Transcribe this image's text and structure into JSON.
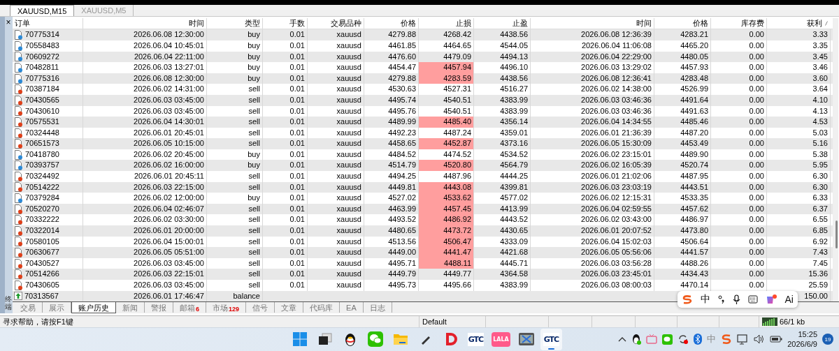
{
  "chart_tabs": [
    {
      "label": "XAUUSD,M15",
      "selected": true
    },
    {
      "label": "XAUUSD,M5",
      "selected": false
    }
  ],
  "terminal": {
    "close": "×",
    "title": "终端"
  },
  "table": {
    "columns": [
      "订单",
      "时间",
      "类型",
      "手数",
      "交易品种",
      "价格",
      "止损",
      "止盈",
      "时间",
      "价格",
      "库存费",
      "获利"
    ],
    "rows": [
      {
        "kind": "buy",
        "order": "70775314",
        "open_time": "2026.06.08 12:30:00",
        "type": "buy",
        "lots": "0.01",
        "symbol": "xauusd",
        "open_price": "4279.88",
        "sl": "4268.42",
        "sl_hit": false,
        "tp": "4438.56",
        "close_time": "2026.06.08 12:36:39",
        "close_price": "4283.21",
        "swap": "0.00",
        "profit": "3.33"
      },
      {
        "kind": "buy",
        "order": "70558483",
        "open_time": "2026.06.04 10:45:01",
        "type": "buy",
        "lots": "0.01",
        "symbol": "xauusd",
        "open_price": "4461.85",
        "sl": "4464.65",
        "sl_hit": false,
        "tp": "4544.05",
        "close_time": "2026.06.04 11:06:08",
        "close_price": "4465.20",
        "swap": "0.00",
        "profit": "3.35"
      },
      {
        "kind": "buy",
        "order": "70609272",
        "open_time": "2026.06.04 22:11:00",
        "type": "buy",
        "lots": "0.01",
        "symbol": "xauusd",
        "open_price": "4476.60",
        "sl": "4479.09",
        "sl_hit": false,
        "tp": "4494.13",
        "close_time": "2026.06.04 22:29:00",
        "close_price": "4480.05",
        "swap": "0.00",
        "profit": "3.45"
      },
      {
        "kind": "buy",
        "order": "70482811",
        "open_time": "2026.06.03 13:27:01",
        "type": "buy",
        "lots": "0.01",
        "symbol": "xauusd",
        "open_price": "4454.47",
        "sl": "4457.94",
        "sl_hit": true,
        "tp": "4496.10",
        "close_time": "2026.06.03 13:29:02",
        "close_price": "4457.93",
        "swap": "0.00",
        "profit": "3.46"
      },
      {
        "kind": "buy",
        "order": "70775316",
        "open_time": "2026.06.08 12:30:00",
        "type": "buy",
        "lots": "0.01",
        "symbol": "xauusd",
        "open_price": "4279.88",
        "sl": "4283.59",
        "sl_hit": true,
        "tp": "4438.56",
        "close_time": "2026.06.08 12:36:41",
        "close_price": "4283.48",
        "swap": "0.00",
        "profit": "3.60"
      },
      {
        "kind": "sell",
        "order": "70387184",
        "open_time": "2026.06.02 14:31:00",
        "type": "sell",
        "lots": "0.01",
        "symbol": "xauusd",
        "open_price": "4530.63",
        "sl": "4527.31",
        "sl_hit": false,
        "tp": "4516.27",
        "close_time": "2026.06.02 14:38:00",
        "close_price": "4526.99",
        "swap": "0.00",
        "profit": "3.64"
      },
      {
        "kind": "sell",
        "order": "70430565",
        "open_time": "2026.06.03 03:45:00",
        "type": "sell",
        "lots": "0.01",
        "symbol": "xauusd",
        "open_price": "4495.74",
        "sl": "4540.51",
        "sl_hit": false,
        "tp": "4383.99",
        "close_time": "2026.06.03 03:46:36",
        "close_price": "4491.64",
        "swap": "0.00",
        "profit": "4.10"
      },
      {
        "kind": "sell",
        "order": "70430610",
        "open_time": "2026.06.03 03:45:00",
        "type": "sell",
        "lots": "0.01",
        "symbol": "xauusd",
        "open_price": "4495.76",
        "sl": "4540.51",
        "sl_hit": false,
        "tp": "4383.99",
        "close_time": "2026.06.03 03:46:36",
        "close_price": "4491.63",
        "swap": "0.00",
        "profit": "4.13"
      },
      {
        "kind": "sell",
        "order": "70575531",
        "open_time": "2026.06.04 14:30:01",
        "type": "sell",
        "lots": "0.01",
        "symbol": "xauusd",
        "open_price": "4489.99",
        "sl": "4485.40",
        "sl_hit": true,
        "tp": "4356.14",
        "close_time": "2026.06.04 14:34:55",
        "close_price": "4485.46",
        "swap": "0.00",
        "profit": "4.53"
      },
      {
        "kind": "sell",
        "order": "70324448",
        "open_time": "2026.06.01 20:45:01",
        "type": "sell",
        "lots": "0.01",
        "symbol": "xauusd",
        "open_price": "4492.23",
        "sl": "4487.24",
        "sl_hit": false,
        "tp": "4359.01",
        "close_time": "2026.06.01 21:36:39",
        "close_price": "4487.20",
        "swap": "0.00",
        "profit": "5.03"
      },
      {
        "kind": "sell",
        "order": "70651573",
        "open_time": "2026.06.05 10:15:00",
        "type": "sell",
        "lots": "0.01",
        "symbol": "xauusd",
        "open_price": "4458.65",
        "sl": "4452.87",
        "sl_hit": true,
        "tp": "4373.16",
        "close_time": "2026.06.05 15:30:09",
        "close_price": "4453.49",
        "swap": "0.00",
        "profit": "5.16"
      },
      {
        "kind": "buy",
        "order": "70418780",
        "open_time": "2026.06.02 20:45:00",
        "type": "buy",
        "lots": "0.01",
        "symbol": "xauusd",
        "open_price": "4484.52",
        "sl": "4474.52",
        "sl_hit": false,
        "tp": "4534.52",
        "close_time": "2026.06.02 23:15:01",
        "close_price": "4489.90",
        "swap": "0.00",
        "profit": "5.38"
      },
      {
        "kind": "buy",
        "order": "70393757",
        "open_time": "2026.06.02 16:00:00",
        "type": "buy",
        "lots": "0.01",
        "symbol": "xauusd",
        "open_price": "4514.79",
        "sl": "4520.80",
        "sl_hit": true,
        "tp": "4564.79",
        "close_time": "2026.06.02 16:05:39",
        "close_price": "4520.74",
        "swap": "0.00",
        "profit": "5.95"
      },
      {
        "kind": "sell",
        "order": "70324492",
        "open_time": "2026.06.01 20:45:11",
        "type": "sell",
        "lots": "0.01",
        "symbol": "xauusd",
        "open_price": "4494.25",
        "sl": "4487.96",
        "sl_hit": false,
        "tp": "4444.25",
        "close_time": "2026.06.01 21:02:06",
        "close_price": "4487.95",
        "swap": "0.00",
        "profit": "6.30"
      },
      {
        "kind": "sell",
        "order": "70514222",
        "open_time": "2026.06.03 22:15:00",
        "type": "sell",
        "lots": "0.01",
        "symbol": "xauusd",
        "open_price": "4449.81",
        "sl": "4443.08",
        "sl_hit": true,
        "tp": "4399.81",
        "close_time": "2026.06.03 23:03:19",
        "close_price": "4443.51",
        "swap": "0.00",
        "profit": "6.30"
      },
      {
        "kind": "buy",
        "order": "70379284",
        "open_time": "2026.06.02 12:00:00",
        "type": "buy",
        "lots": "0.01",
        "symbol": "xauusd",
        "open_price": "4527.02",
        "sl": "4533.62",
        "sl_hit": true,
        "tp": "4577.02",
        "close_time": "2026.06.02 12:15:31",
        "close_price": "4533.35",
        "swap": "0.00",
        "profit": "6.33"
      },
      {
        "kind": "sell",
        "order": "70520270",
        "open_time": "2026.06.04 02:46:07",
        "type": "sell",
        "lots": "0.01",
        "symbol": "xauusd",
        "open_price": "4463.99",
        "sl": "4457.45",
        "sl_hit": true,
        "tp": "4413.99",
        "close_time": "2026.06.04 02:59:55",
        "close_price": "4457.62",
        "swap": "0.00",
        "profit": "6.37"
      },
      {
        "kind": "sell",
        "order": "70332222",
        "open_time": "2026.06.02 03:30:00",
        "type": "sell",
        "lots": "0.01",
        "symbol": "xauusd",
        "open_price": "4493.52",
        "sl": "4486.92",
        "sl_hit": true,
        "tp": "4443.52",
        "close_time": "2026.06.02 03:43:00",
        "close_price": "4486.97",
        "swap": "0.00",
        "profit": "6.55"
      },
      {
        "kind": "sell",
        "order": "70322014",
        "open_time": "2026.06.01 20:00:00",
        "type": "sell",
        "lots": "0.01",
        "symbol": "xauusd",
        "open_price": "4480.65",
        "sl": "4473.72",
        "sl_hit": true,
        "tp": "4430.65",
        "close_time": "2026.06.01 20:07:52",
        "close_price": "4473.80",
        "swap": "0.00",
        "profit": "6.85"
      },
      {
        "kind": "sell",
        "order": "70580105",
        "open_time": "2026.06.04 15:00:01",
        "type": "sell",
        "lots": "0.01",
        "symbol": "xauusd",
        "open_price": "4513.56",
        "sl": "4506.47",
        "sl_hit": true,
        "tp": "4333.09",
        "close_time": "2026.06.04 15:02:03",
        "close_price": "4506.64",
        "swap": "0.00",
        "profit": "6.92"
      },
      {
        "kind": "sell",
        "order": "70630677",
        "open_time": "2026.06.05 05:51:00",
        "type": "sell",
        "lots": "0.01",
        "symbol": "xauusd",
        "open_price": "4449.00",
        "sl": "4441.47",
        "sl_hit": true,
        "tp": "4421.68",
        "close_time": "2026.06.05 05:56:06",
        "close_price": "4441.57",
        "swap": "0.00",
        "profit": "7.43"
      },
      {
        "kind": "sell",
        "order": "70430527",
        "open_time": "2026.06.03 03:45:00",
        "type": "sell",
        "lots": "0.01",
        "symbol": "xauusd",
        "open_price": "4495.71",
        "sl": "4488.11",
        "sl_hit": true,
        "tp": "4445.71",
        "close_time": "2026.06.03 03:56:28",
        "close_price": "4488.26",
        "swap": "0.00",
        "profit": "7.45"
      },
      {
        "kind": "sell",
        "order": "70514266",
        "open_time": "2026.06.03 22:15:01",
        "type": "sell",
        "lots": "0.01",
        "symbol": "xauusd",
        "open_price": "4449.79",
        "sl": "4449.77",
        "sl_hit": false,
        "tp": "4364.58",
        "close_time": "2026.06.03 23:45:01",
        "close_price": "4434.43",
        "swap": "0.00",
        "profit": "15.36"
      },
      {
        "kind": "sell",
        "order": "70430605",
        "open_time": "2026.06.03 03:45:00",
        "type": "sell",
        "lots": "0.01",
        "symbol": "xauusd",
        "open_price": "4495.73",
        "sl": "4495.66",
        "sl_hit": false,
        "tp": "4383.99",
        "close_time": "2026.06.03 08:00:03",
        "close_price": "4470.14",
        "swap": "0.00",
        "profit": "25.59"
      },
      {
        "kind": "balance",
        "order": "70313567",
        "open_time": "2026.06.01 17:46:47",
        "type": "balance",
        "profit": "150.00"
      }
    ]
  },
  "bottom_tabs": [
    {
      "label": "交易",
      "selected": false
    },
    {
      "label": "展示",
      "selected": false
    },
    {
      "label": "账户历史",
      "selected": true
    },
    {
      "label": "新闻",
      "selected": false
    },
    {
      "label": "警报",
      "selected": false
    },
    {
      "label": "邮箱",
      "selected": false,
      "badge": "6"
    },
    {
      "label": "市场",
      "selected": false,
      "badge": "129"
    },
    {
      "label": "信号",
      "selected": false
    },
    {
      "label": "文章",
      "selected": false
    },
    {
      "label": "代码库",
      "selected": false
    },
    {
      "label": "EA",
      "selected": false
    },
    {
      "label": "日志",
      "selected": false
    }
  ],
  "ime_toolbar": {
    "mode": "中",
    "ai": "Ai"
  },
  "status_bar": {
    "help": "寻求帮助，请按F1键",
    "profile": "Default",
    "traffic": "66/1 kb"
  },
  "taskbar": {
    "apps": [
      {
        "kind": "start",
        "active": false
      },
      {
        "kind": "taskview",
        "active": false
      },
      {
        "kind": "penguin",
        "active": false
      },
      {
        "kind": "chat",
        "active": false
      },
      {
        "kind": "folder",
        "active": false
      },
      {
        "kind": "pen",
        "active": false
      },
      {
        "kind": "redd",
        "active": false
      },
      {
        "kind": "logo",
        "label": "GTC",
        "active": false
      },
      {
        "kind": "pinklogo",
        "label": "LALA",
        "active": false
      },
      {
        "kind": "scissors",
        "active": false
      },
      {
        "kind": "logo",
        "label": "GTC",
        "active": true
      }
    ],
    "tray": {
      "ime": "中",
      "time": "15:25",
      "date": "2026/6/9",
      "notifications": "19"
    }
  }
}
